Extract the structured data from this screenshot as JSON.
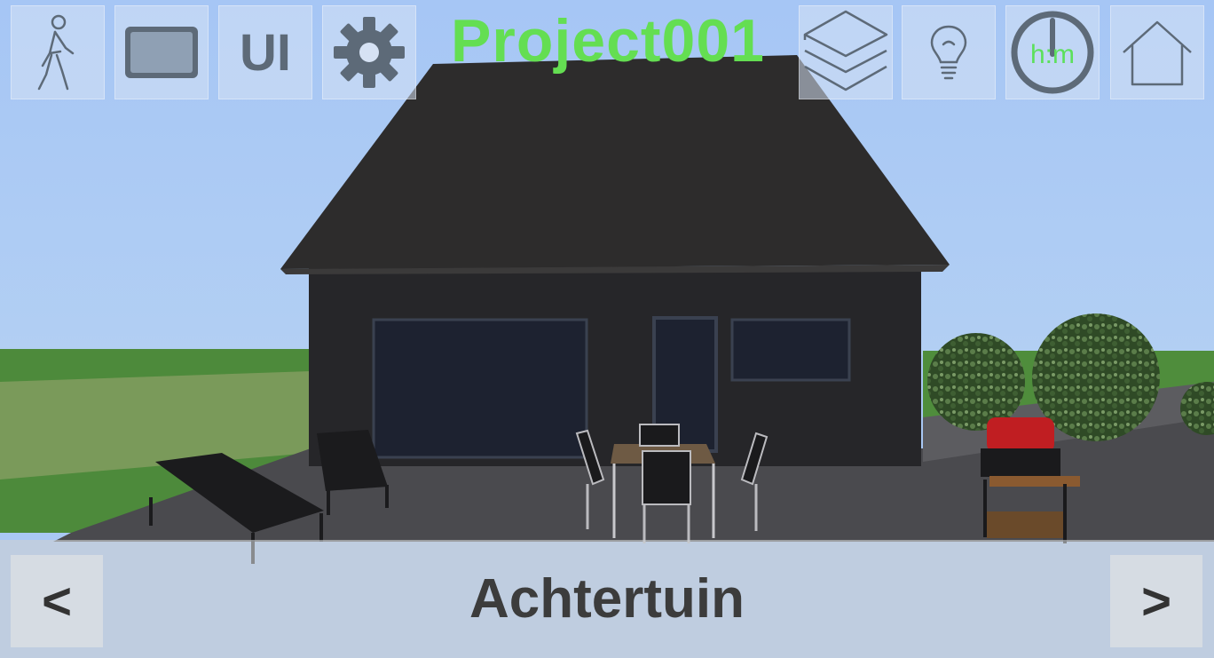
{
  "project": {
    "title": "Project001"
  },
  "toolbar": {
    "walk": {
      "icon": "walking-person-icon"
    },
    "screen": {
      "icon": "screen-frame-icon"
    },
    "ui": {
      "label": "UI",
      "icon": "ui-toggle-icon"
    },
    "settings": {
      "icon": "gear-icon"
    },
    "layers": {
      "icon": "layers-icon"
    },
    "light": {
      "icon": "lightbulb-icon"
    },
    "clock": {
      "label": "h:m",
      "icon": "clock-icon"
    },
    "home": {
      "icon": "home-icon"
    }
  },
  "navigation": {
    "prev_label": "<",
    "next_label": ">",
    "location": "Achtertuin"
  },
  "colors": {
    "title": "#64de52",
    "sky": "#a9c8f4",
    "house_wall": "#262629",
    "roof": "#2c2b2b",
    "grass": "#4a8a3a",
    "clock_text": "#5ce05c",
    "toolbar_icon": "#5d6a78"
  }
}
